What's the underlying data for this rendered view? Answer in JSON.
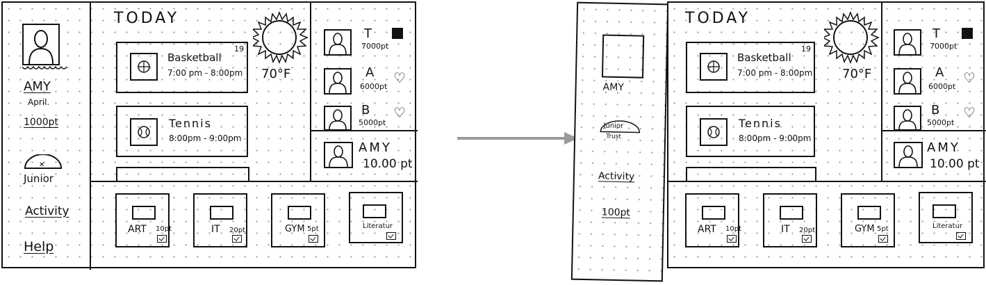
{
  "user": {
    "name": "AMY",
    "month": "April.",
    "points": "1000pt",
    "rank_label": "Junior",
    "sub_name": "AMY",
    "sub_rank_line1": "Junior",
    "sub_rank_line2": "Trust",
    "sub_activity": "Activity",
    "sub_points": "100pt"
  },
  "nav": {
    "activity": "Activity",
    "help": "Help"
  },
  "today": {
    "title": "TODAY",
    "temperature": "70°F",
    "events": [
      {
        "name": "Basketball",
        "date": "19",
        "time": "7:00 pm - 8:00pm"
      },
      {
        "name": "Tennis",
        "time": "8:00pm - 9:00pm"
      }
    ]
  },
  "leaderboard": [
    {
      "initial": "T",
      "points": "7000pt",
      "marker": "filled-square"
    },
    {
      "initial": "A",
      "points": "6000pt",
      "marker": "heart"
    },
    {
      "initial": "B",
      "points": "5000pt",
      "marker": "heart"
    }
  ],
  "self_entry": {
    "name": "AMY",
    "points": "10.00 pt"
  },
  "categories": [
    {
      "name": "ART",
      "points": "10pt"
    },
    {
      "name": "IT",
      "points": "20pt"
    },
    {
      "name": "GYM",
      "points": "5pt"
    },
    {
      "name": "Literatur",
      "points": ""
    }
  ]
}
